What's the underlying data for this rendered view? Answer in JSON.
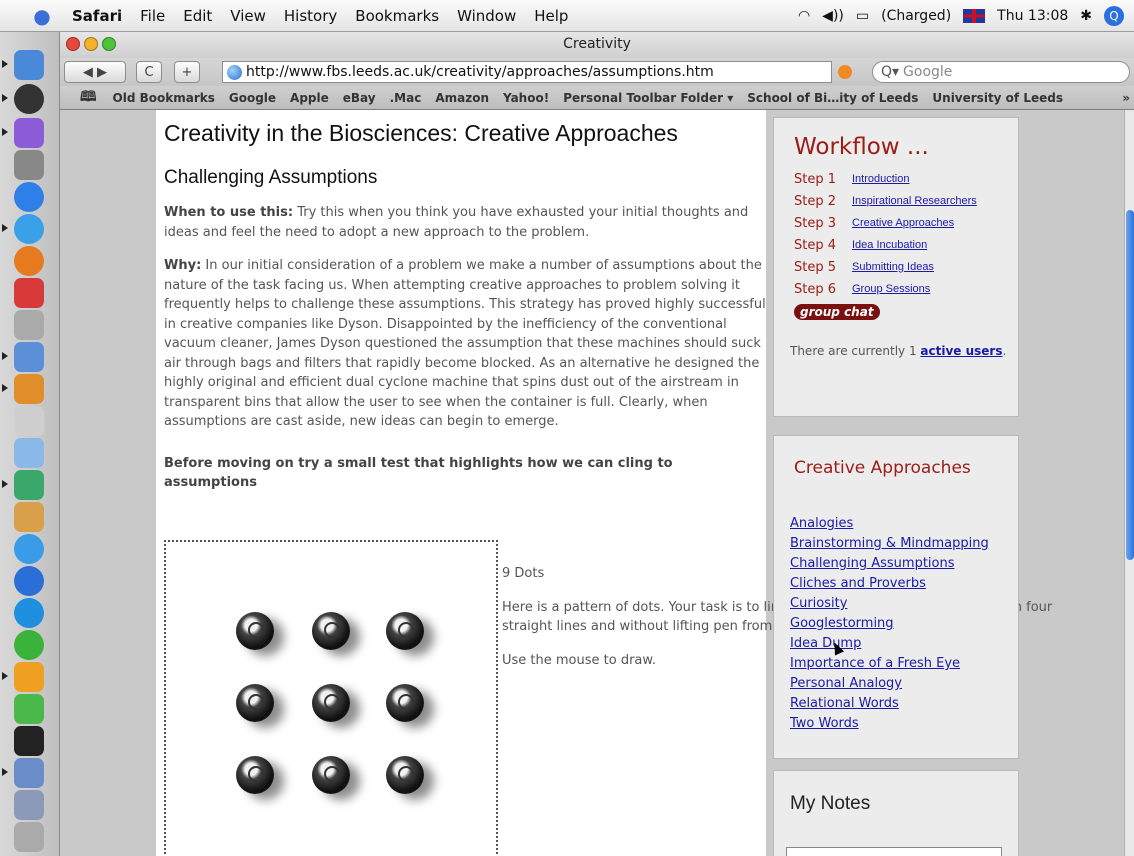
{
  "menubar": {
    "app": "Safari",
    "menus": [
      "File",
      "Edit",
      "View",
      "History",
      "Bookmarks",
      "Window",
      "Help"
    ],
    "battery": "(Charged)",
    "clock": "Thu 13:08"
  },
  "window": {
    "title": "Creativity"
  },
  "toolbar": {
    "back_forward": "◀ ▶",
    "reload": "C",
    "add": "+",
    "url": "http://www.fbs.leeds.ac.uk/creativity/approaches/assumptions.htm",
    "search_placeholder": "Google",
    "search_glyph": "Q▾"
  },
  "bookmarks": [
    "Old Bookmarks",
    "Google",
    "Apple",
    "eBay",
    ".Mac",
    "Amazon",
    "Yahoo!",
    "Personal Toolbar Folder ▾",
    "School of Bi…ity of Leeds",
    "University of Leeds"
  ],
  "bookmarks_more": "»",
  "page": {
    "title": "Creativity in the Biosciences: Creative Approaches",
    "subtitle": "Challenging Assumptions",
    "when_label": "When to use this:",
    "when_text": " Try this when you think you have exhausted your initial thoughts and ideas and feel the need to adopt a new approach to the problem.",
    "why_label": "Why:",
    "why_text": " In our initial consideration of a problem we make a number of assumptions about the nature of the task facing us. When attempting creative approaches to problem solving it frequently helps to challenge these assumptions. This strategy has proved highly successful in creative companies like Dyson. Disappointed by the inefficiency of the conventional vacuum cleaner, James Dyson questioned the assumption that these machines should suck air through bags and filters that rapidly become blocked. As an alternative he designed the highly original and efficient dual cyclone machine that spins dust out of the airstream in transparent bins that allow the user to see when the container is full. Clearly, when assumptions are cast aside, new ideas can begin to emerge.",
    "lead": "Before moving on try a small test that highlights how we can cling to assumptions",
    "dots_title": "9 Dots",
    "dots_desc": "Here is a pattern of dots. Your task is to link up all nine dots using no more than four straight lines and without lifting pen from paper or retracing the lines.",
    "dots_hint": "Use the mouse to draw."
  },
  "workflow": {
    "title": "Workflow ...",
    "steps": [
      {
        "num": "Step 1",
        "label": "Introduction"
      },
      {
        "num": "Step 2",
        "label": "Inspirational Researchers"
      },
      {
        "num": "Step 3",
        "label": "Creative Approaches"
      },
      {
        "num": "Step 4",
        "label": "Idea Incubation"
      },
      {
        "num": "Step 5",
        "label": "Submitting Ideas"
      },
      {
        "num": "Step 6",
        "label": "Group Sessions"
      }
    ],
    "groupchat": "group chat",
    "users_pre": "There are currently 1 ",
    "users_link": "active users",
    "users_post": "."
  },
  "approaches": {
    "title": "Creative Approaches",
    "items": [
      "Analogies",
      "Brainstorming & Mindmapping",
      "Challenging Assumptions",
      "Cliches and Proverbs",
      "Curiosity",
      "Googlestorming",
      "Idea Dump",
      "Importance of a Fresh Eye",
      "Personal Analogy",
      "Relational Words",
      "Two Words"
    ]
  },
  "notes": {
    "title": "My Notes"
  }
}
